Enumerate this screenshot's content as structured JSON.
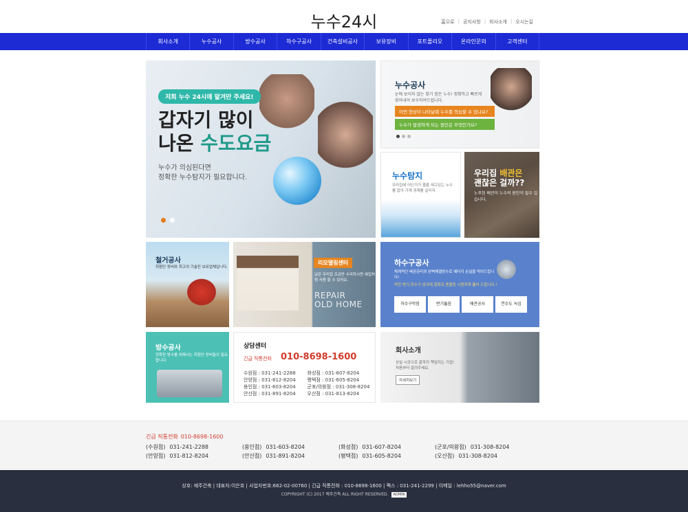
{
  "header": {
    "logo": "누수24시",
    "top_links": [
      "홈으로",
      "공지사항",
      "회사소개",
      "오시는길"
    ]
  },
  "nav": [
    "회사소개",
    "누수공사",
    "방수공사",
    "하수구공사",
    "건축설비공사",
    "보유장비",
    "포트폴리오",
    "온라인문의",
    "고객센터"
  ],
  "hero": {
    "badge": "저희 누수 24시에 맡겨만 주세요!",
    "headline_1": "갑자기 많이",
    "headline_2a": "나온 ",
    "headline_2b": "수도요금",
    "sub_1": "누수가 의심된다면",
    "sub_2": "정확한 누수탐지가 필요합니다."
  },
  "leak": {
    "title": "누수공사",
    "desc": "눈에 보이지 않는 찾기 힘든 누수! 정확하고 빠르게 찾아내어 보수하여드립니다.",
    "q1": "어떤 현상이 나타날때 누수를 의심할 수 있나요?",
    "q2": "누수가 발생하게 되는 원인은 무엇인가요?"
  },
  "detect": {
    "title": "누수탐지",
    "desc": "우리집에 어딘가가 줄줄 새고있는 누수를 잡아 가계 경제를 살리자."
  },
  "pipe": {
    "title_1a": "우리집 ",
    "title_1b": "배관은",
    "title_2": "괜찮은 걸까??",
    "desc": "노후된 배관이 누수의 원인이 될수 있습니다."
  },
  "demolition": {
    "title": "철거공사",
    "desc": "최첨단 장비와 최고의 기술진 보유업체입니다."
  },
  "remodel": {
    "badge": "리모델링센터",
    "desc": "낡은 우리집 조금만 수리하시면 새집처럼 사용 할 수 있어요.",
    "big_1": "REPAIR",
    "big_2": "OLD HOME"
  },
  "sewer": {
    "title": "하수구공사",
    "desc": "체계적인 배관관리와 완벽해결방수로 예더지 손실을 막아드립니다!",
    "desc2": "막힌 변기,하수구,씽크대,청화조,맨홀등 시원하게 뚫어 드립니다.!",
    "buttons": [
      "하수구막힘",
      "변기뚫음",
      "배관공사",
      "연수도 녹임"
    ]
  },
  "waterproof": {
    "title": "방수공사",
    "desc": "정확한 방수를 위해서는 최첨단 장비들이 필요합니다."
  },
  "consult": {
    "title": "상담센터",
    "emergency_label": "긴급 직통전화",
    "emergency_tel": "010-8698-1600",
    "branches": [
      "수원점 : 031-241-2288",
      "화성점 : 031-607-8204",
      "안양점 : 031-812-8204",
      "평택점 : 031-605-8204",
      "용인점 : 031-603-8204",
      "군포/의왕점 : 031-308-8204",
      "안산점 : 031-891-8204",
      "오산점 : 031-813-8204"
    ]
  },
  "company": {
    "title": "회사소개",
    "desc_1": "상실 시공으로 끝까지 책임지는 기업!",
    "desc_2": "처음부터 알려주세요.",
    "more": "자세히보기"
  },
  "footer_info": {
    "emergency_label": "긴급 직통전화",
    "emergency_tel": "010-8698-1600",
    "branches": [
      {
        "name": "(수원점)",
        "tel": "031-241-2288"
      },
      {
        "name": "(용인점)",
        "tel": "031-603-8204"
      },
      {
        "name": "(화성점)",
        "tel": "031-607-8204"
      },
      {
        "name": "(군포/의왕점)",
        "tel": "031-308-8204"
      },
      {
        "name": "(안양점)",
        "tel": "031-812-8204"
      },
      {
        "name": "(안산점)",
        "tel": "031-891-8204"
      },
      {
        "name": "(평택점)",
        "tel": "031-605-8204"
      },
      {
        "name": "(오산점)",
        "tel": "031-308-8204"
      }
    ]
  },
  "footer": {
    "line1": "상호: 예주건축 | 대표자:이은호 | 사업자번호:662-02-00760 | 긴급 직통전화 : 010-8698-1600 | 팩스 : 031-241-2299 | 이메일 : lehho55@naver.com",
    "line2": "COPYRIGHT (C) 2017 예주건축 ALL RIGHT RESERVED.",
    "admin": "ADMIN"
  }
}
